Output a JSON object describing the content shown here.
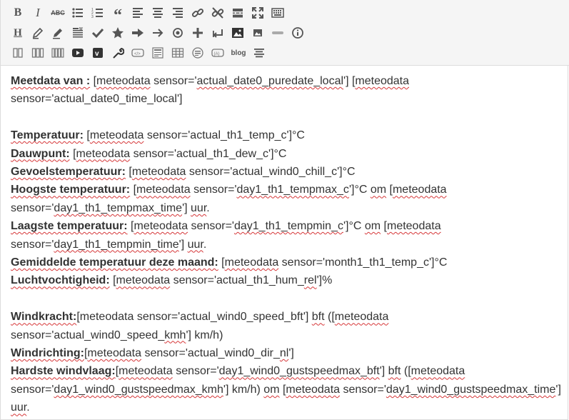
{
  "toolbar": {
    "row1": [
      "bold",
      "italic",
      "strikethrough",
      "bullet-list",
      "numbered-list",
      "blockquote",
      "align-left",
      "align-center",
      "align-right",
      "insert-link",
      "remove-link",
      "read-more",
      "fullscreen",
      "toolbar-toggle"
    ],
    "row2": [
      "heading",
      "pencil",
      "pencil-alt",
      "paste-text",
      "checkmark",
      "star",
      "arrow-right-bold",
      "arrow-right",
      "radio-circle",
      "plus",
      "return",
      "image",
      "image-small",
      "horizontal-rule",
      "help"
    ],
    "row3": [
      "columns-2",
      "columns-3",
      "columns-4",
      "youtube",
      "vimeo",
      "wrench",
      "shortcode",
      "template",
      "table",
      "widget",
      "code",
      "blog",
      "text-align"
    ],
    "blog_label": "blog"
  },
  "content": {
    "l1_label": "Meetdata van :",
    "l1_pre": " [",
    "l1_sp1": "meteodata",
    "l1_mid": " sensor='",
    "l1_sp2": "actual_date0_puredate_local",
    "l1_mid2": "'] [",
    "l1_sp3": "meteodata",
    "l2_text": "sensor='actual_date0_time_local']",
    "temp_label": "Temperatuur:",
    "temp_a": " [",
    "temp_sp": "meteodata",
    "temp_b": " sensor='actual_th1_temp_c']°C",
    "dauw_label": "Dauwpunt:",
    "dauw_a": " [",
    "dauw_sp": "meteodata",
    "dauw_b": " sensor='actual_th1_dew_c']°C",
    "gevoel_label": "Gevoelstemperatuur:",
    "gevoel_a": " [",
    "gevoel_sp": "meteodata",
    "gevoel_b": " sensor='actual_wind0_chill_c']°C",
    "hoog_label": "Hoogste temperatuur:",
    "hoog_a": " [",
    "hoog_sp1": "meteodata",
    "hoog_b": " sensor='",
    "hoog_sp2": "day1_th1_tempmax_c",
    "hoog_c": "']°C ",
    "hoog_sp3": "om",
    "hoog_d": " [",
    "hoog_sp4": "meteodata",
    "hoog2_a": "sensor='",
    "hoog2_sp1": "day1_th1_tempmax_time",
    "hoog2_b": "'] ",
    "hoog2_sp2": "uur",
    "hoog2_c": ".",
    "laag_label": "Laagste temperatuur:",
    "laag_a": " [",
    "laag_sp1": "meteodata",
    "laag_b": " sensor='",
    "laag_sp2": "day1_th1_tempmin_c",
    "laag_c": "']°C ",
    "laag_sp3": "om",
    "laag_d": " [",
    "laag_sp4": "meteodata",
    "laag2_a": "sensor='",
    "laag2_sp1": "day1_th1_tempmin_time",
    "laag2_b": "'] ",
    "laag2_sp2": "uur",
    "laag2_c": ".",
    "gem_label": "Gemiddelde temperatuur deze maand:",
    "gem_a": " [",
    "gem_sp": "meteodata",
    "gem_b": " sensor='month1_th1_temp_c']°C",
    "lucht_label": "Luchtvochtigheid:",
    "lucht_a": " [",
    "lucht_sp1": "meteodata",
    "lucht_b": " sensor='actual_th1_hum_",
    "lucht_sp2": "rel",
    "lucht_c": "']%",
    "wk_label": "Windkracht:",
    "wk_a": "[meteodata sensor='actual_wind0_speed_bft'] ",
    "wk_sp1": "bft",
    "wk_b": " ([",
    "wk_sp2": "meteodata",
    "wk2_a": "sensor='actual_wind0_speed_",
    "wk2_sp": "kmh",
    "wk2_b": "'] km/h)",
    "wr_label": "Windrichting:",
    "wr_a": "[",
    "wr_sp1": "meteodata",
    "wr_b": " sensor='actual_wind0_dir_",
    "wr_sp2": "nl",
    "wr_c": "']",
    "hw_label": "Hardste windvlaag:",
    "hw_a": "[",
    "hw_sp1": "meteodata",
    "hw_b": " sensor='",
    "hw_sp2": "day1_wind0_gustspeedmax_bft",
    "hw_c": "'] ",
    "hw_sp3": "bft",
    "hw_d": " ([",
    "hw_sp4": "meteodata",
    "hw2_a": "sensor='",
    "hw2_sp1": "day1_wind0_gustspeedmax_kmh",
    "hw2_b": "'] km/h) ",
    "hw2_sp2": "om",
    "hw2_c": " [",
    "hw2_sp3": "meteodata",
    "hw2_d": " sensor='",
    "hw2_sp4": "day1_wind0_gustspeedmax_time",
    "hw2_e": "']",
    "hw3_sp": "uur",
    "hw3_a": "."
  },
  "colors": {
    "spellcheck": "#d63638",
    "toolbar_bg": "#f5f5f5",
    "text": "#333333"
  }
}
